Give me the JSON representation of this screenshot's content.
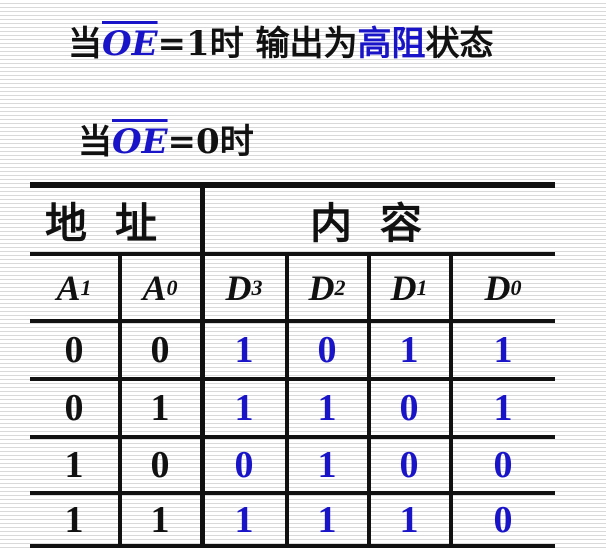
{
  "line1": {
    "prefix": "当",
    "oe": "OE",
    "rest": "=1时 输出为",
    "highlight": "高阻",
    "suffix": "状态"
  },
  "line2": {
    "prefix": "当",
    "oe": "OE",
    "rest": "=0时"
  },
  "table": {
    "header_address": "地址",
    "header_content": "内容",
    "columns": [
      {
        "letter": "A",
        "sub": "1"
      },
      {
        "letter": "A",
        "sub": "0"
      },
      {
        "letter": "D",
        "sub": "3"
      },
      {
        "letter": "D",
        "sub": "2"
      },
      {
        "letter": "D",
        "sub": "1"
      },
      {
        "letter": "D",
        "sub": "0"
      }
    ],
    "rows": [
      [
        "0",
        "0",
        "1",
        "0",
        "1",
        "1"
      ],
      [
        "0",
        "1",
        "1",
        "1",
        "0",
        "1"
      ],
      [
        "1",
        "0",
        "0",
        "1",
        "0",
        "0"
      ],
      [
        "1",
        "1",
        "1",
        "1",
        "1",
        "0"
      ]
    ],
    "colors": {
      "address": "#111111",
      "content": "#1a14c8"
    }
  }
}
